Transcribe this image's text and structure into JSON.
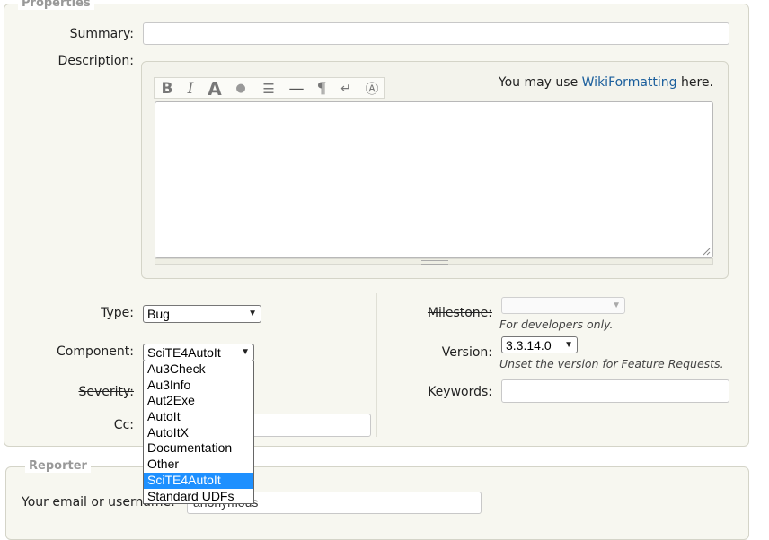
{
  "properties": {
    "legend": "Properties",
    "summary_label": "Summary:",
    "summary_value": "",
    "description_label": "Description:",
    "wiki_prefix": "You may use ",
    "wiki_link": "WikiFormatting",
    "wiki_suffix": " here.",
    "toolbar": [
      {
        "name": "bold-button",
        "glyph": "B"
      },
      {
        "name": "italic-button",
        "glyph": "I"
      },
      {
        "name": "heading-button",
        "glyph": "A"
      },
      {
        "name": "link-button",
        "glyph": "●"
      },
      {
        "name": "code-block-button",
        "glyph": "☰"
      },
      {
        "name": "horizontal-rule-button",
        "glyph": "—"
      },
      {
        "name": "paragraph-button",
        "glyph": "¶"
      },
      {
        "name": "line-break-button",
        "glyph": "↵"
      },
      {
        "name": "image-button",
        "glyph": "Ⓐ"
      }
    ],
    "type_label": "Type:",
    "type_value": "Bug",
    "component_label": "Component:",
    "component_value": "SciTE4AutoIt",
    "component_options": [
      "Au3Check",
      "Au3Info",
      "Aut2Exe",
      "AutoIt",
      "AutoItX",
      "Documentation",
      "Other",
      "SciTE4AutoIt",
      "Standard UDFs"
    ],
    "component_selected_index": 7,
    "severity_label": "Severity:",
    "cc_label": "Cc:",
    "cc_value": "",
    "milestone_label": "Milestone:",
    "milestone_value": "",
    "milestone_hint": "For developers only.",
    "version_label": "Version:",
    "version_value": "3.3.14.0",
    "version_hint": "Unset the version for Feature Requests.",
    "keywords_label": "Keywords:",
    "keywords_value": ""
  },
  "reporter": {
    "legend": "Reporter",
    "email_label": "Your email or username:",
    "email_value": "anonymous"
  },
  "colors": {
    "fieldset_bg": "#f7f7f0",
    "link": "#1a5e9c",
    "selected_option": "#1e90ff"
  }
}
